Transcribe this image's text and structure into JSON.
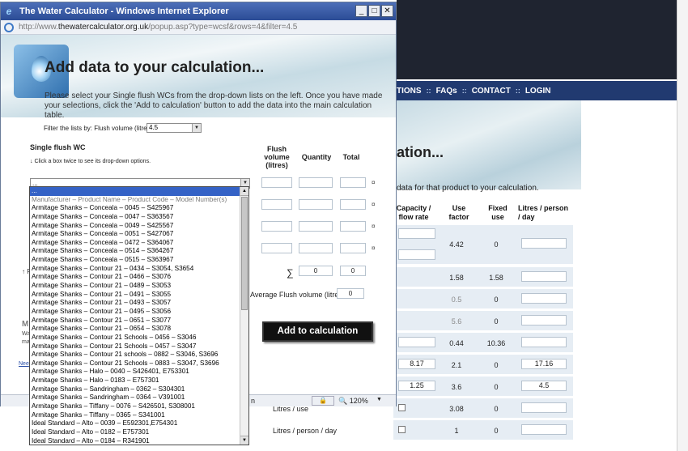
{
  "window": {
    "title": "The Water Calculator - Windows Internet Explorer",
    "icon": "ie-icon",
    "url_prefix": "http://www.",
    "url_domain": "thewatercalculator.org.uk",
    "url_path": "/popup.asp?type=wcsf&rows=4&filter=4.5",
    "minimize_label": "_",
    "maximize_label": "□",
    "close_label": "✕"
  },
  "popup": {
    "heading": "Add data to your calculation...",
    "intro": "Please select your Single flush WCs from the drop-down lists on the left. Once you have made your selections, click the 'Add to calculation' button to add the data into the main calculation table.",
    "filter_label": "Filter the lists by: Flush volume (litres):",
    "filter_value": "4.5",
    "section_title": "Single flush WC",
    "section_hint": "↓ Click a box twice to see its drop-down options.",
    "columns": {
      "flush_volume": "Flush volume (litres)",
      "quantity": "Quantity",
      "total": "Total"
    },
    "select_value": "...",
    "row_delete_mark": "¤",
    "sum_symbol": "∑",
    "sum_quantity": "0",
    "sum_total": "0",
    "average_label": "Average Flush volume (litres)",
    "average_value": "0",
    "add_button": "Add to calculation",
    "left_frag_1": "↑ F",
    "left_frag_2": "M",
    "left_frag_3a": "Wa",
    "left_frag_3b": "ma",
    "left_frag_4": "Nee",
    "status_text": "n",
    "zoom_icon": "🔒",
    "zoom_label": "🔍 120%",
    "zoom_arrow": "▼"
  },
  "dropdown": {
    "items": [
      "...",
      "Manufacturer – Product Name – Product Code – Model Number(s)",
      "Armitage Shanks – Conceala – 0045 – S425967",
      "Armitage Shanks – Conceala – 0047 – S363567",
      "Armitage Shanks – Conceala – 0049 – S425567",
      "Armitage Shanks – Conceala – 0051 – S427067",
      "Armitage Shanks – Conceala – 0472 – S364067",
      "Armitage Shanks – Conceala – 0514 – S364267",
      "Armitage Shanks – Conceala – 0515 – S363967",
      "Armitage Shanks – Contour 21 – 0434 – S3054, S3654",
      "Armitage Shanks – Contour 21 – 0466 – S3076",
      "Armitage Shanks – Contour 21 – 0489 – S3053",
      "Armitage Shanks – Contour 21 – 0491 – S3055",
      "Armitage Shanks – Contour 21 – 0493 – S3057",
      "Armitage Shanks – Contour 21 – 0495 – S3056",
      "Armitage Shanks – Contour 21 – 0651 – S3077",
      "Armitage Shanks – Contour 21 – 0654 – S3078",
      "Armitage Shanks – Contour 21 Schools – 0456 – S3046",
      "Armitage Shanks – Contour 21 Schools – 0457 – S3047",
      "Armitage Shanks – Contour 21 schools – 0882 – S3046, S3696",
      "Armitage Shanks – Contour 21 Schools – 0883 – S3047, S3696",
      "Armitage Shanks – Halo – 0040 – S426401, E753301",
      "Armitage Shanks – Halo – 0183 – E757301",
      "Armitage Shanks – Sandringham – 0362 – S304301",
      "Armitage Shanks – Sandringham – 0364 – V391001",
      "Armitage Shanks – Tiffany – 0076 – S426501, S308001",
      "Armitage Shanks – Tiffany – 0365 – S341001",
      "Ideal Standard – Alto – 0039 – E592301,E754301",
      "Ideal Standard – Alto – 0182 – E757301",
      "Ideal Standard – Alto – 0184 – R341901"
    ],
    "scroll_up": "▲",
    "scroll_down": "▼"
  },
  "background_page": {
    "nav": [
      "TIONS",
      "::",
      "FAQs",
      "::",
      "CONTACT",
      "::",
      "LOGIN"
    ],
    "banner_title": "ation...",
    "intro": "data for that product to your calculation.",
    "headers": {
      "capacity": "Capacity / flow rate",
      "use_factor": "Use factor",
      "fixed_use": "Fixed use",
      "litres_day": "Litres / person / day"
    },
    "rows": [
      {
        "use_factor": "4.42",
        "fixed_use": "0",
        "litres": ""
      },
      {
        "use_factor": "1.58",
        "fixed_use": "1.58",
        "litres": ""
      },
      {
        "use_factor": "0.5",
        "fixed_use": "0",
        "litres": ""
      },
      {
        "use_factor": "5.6",
        "fixed_use": "0",
        "litres": ""
      },
      {
        "use_factor": "0.44",
        "fixed_use": "10.36",
        "litres": ""
      },
      {
        "capacity": "8.17",
        "use_factor": "2.1",
        "fixed_use": "0",
        "litres": "17.16"
      },
      {
        "capacity": "1.25",
        "use_factor": "3.6",
        "fixed_use": "0",
        "litres": "4.5"
      },
      {
        "label": "Litres / use",
        "use_factor": "3.08",
        "fixed_use": "0",
        "litres": ""
      },
      {
        "label": "Litres / person / day",
        "use_factor": "1",
        "fixed_use": "0",
        "litres": ""
      }
    ]
  },
  "colors": {
    "titlebar": "#2b4c96",
    "selection": "#3462c6",
    "button_bg": "#111111",
    "nav_bg": "#213a70"
  }
}
